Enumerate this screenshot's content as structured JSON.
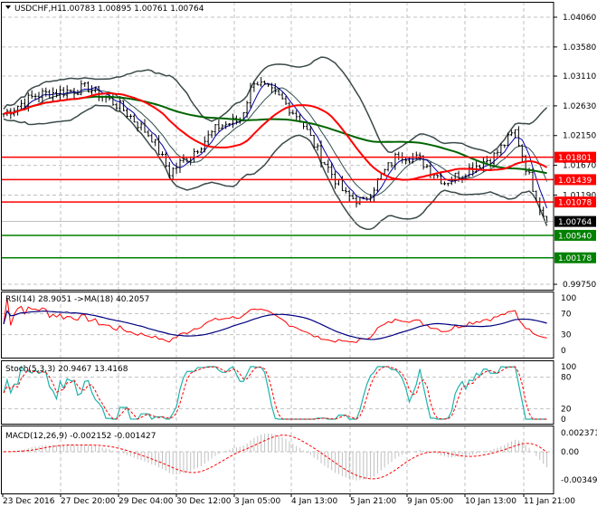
{
  "header": {
    "symbol": "USDCHF,H1",
    "ohlc": "1.00783 1.00895 1.00761 1.00764"
  },
  "colors": {
    "ma_fast": "#ff0000",
    "ma_slow": "#006400",
    "bands": "#3c4a4a",
    "rsi": "#ff0000",
    "rsi_ma": "#000080",
    "stoch_main": "#20b2aa",
    "stoch_signal": "#ff0000",
    "macd_hist": "#c0c0c0",
    "macd_signal": "#ff0000",
    "grid": "#c0c0c0"
  },
  "chart_data": {
    "type": "line",
    "title": "USDCHF,H1",
    "price_axis": {
      "ticks": [
        "1.04060",
        "1.03580",
        "1.03110",
        "1.02630",
        "1.02150",
        "1.01670",
        "1.01190",
        "0.99750"
      ],
      "ylim": [
        0.9975,
        1.0406
      ]
    },
    "time_ticks": [
      "23 Dec 2016",
      "27 Dec 20:00",
      "29 Dec 04:00",
      "30 Dec 12:00",
      "3 Jan 05:00",
      "4 Jan 13:00",
      "5 Jan 21:00",
      "9 Jan 05:00",
      "10 Jan 13:00",
      "11 Jan 21:00"
    ],
    "price_waypoints": [
      [
        0,
        1.025
      ],
      [
        9,
        1.028
      ],
      [
        24,
        1.0292
      ],
      [
        33,
        1.0262
      ],
      [
        42,
        1.0212
      ],
      [
        47,
        1.0155
      ],
      [
        54,
        1.019
      ],
      [
        61,
        1.023
      ],
      [
        67,
        1.024
      ],
      [
        71,
        1.0305
      ],
      [
        79,
        1.0272
      ],
      [
        84,
        1.0242
      ],
      [
        90,
        1.018
      ],
      [
        97,
        1.0118
      ],
      [
        102,
        1.0108
      ],
      [
        107,
        1.015
      ],
      [
        112,
        1.0186
      ],
      [
        118,
        1.0176
      ],
      [
        125,
        1.014
      ],
      [
        131,
        1.0158
      ],
      [
        139,
        1.0182
      ],
      [
        145,
        1.0222
      ],
      [
        148,
        1.0165
      ],
      [
        152,
        1.01
      ],
      [
        154,
        1.00764
      ]
    ],
    "levels": [
      {
        "label": "1.01801",
        "value": 1.01801,
        "color": "#ff0000"
      },
      {
        "label": "1.01439",
        "value": 1.01439,
        "color": "#ff0000"
      },
      {
        "label": "1.01078",
        "value": 1.01078,
        "color": "#ff0000"
      },
      {
        "label": "1.00540",
        "value": 1.0054,
        "color": "#008000"
      },
      {
        "label": "1.00178",
        "value": 1.00178,
        "color": "#008000"
      }
    ],
    "current_price": {
      "label": "1.00764",
      "value": 1.00764
    },
    "indicators": [
      {
        "name": "rsi",
        "title": "RSI(14) 28.9051  ->MA(18) 40.2057",
        "ticks": [
          "100",
          "70",
          "30",
          "0"
        ]
      },
      {
        "name": "stoch",
        "title": "Stoch(5,3,3) 20.9467 13.4168",
        "ticks": [
          "100",
          "80",
          "20",
          "0"
        ]
      },
      {
        "name": "macd",
        "title": "MACD(12,26,9) -0.002152 -0.001427",
        "ticks": [
          "0.002371",
          "0.00",
          "-0.003494"
        ]
      }
    ]
  }
}
